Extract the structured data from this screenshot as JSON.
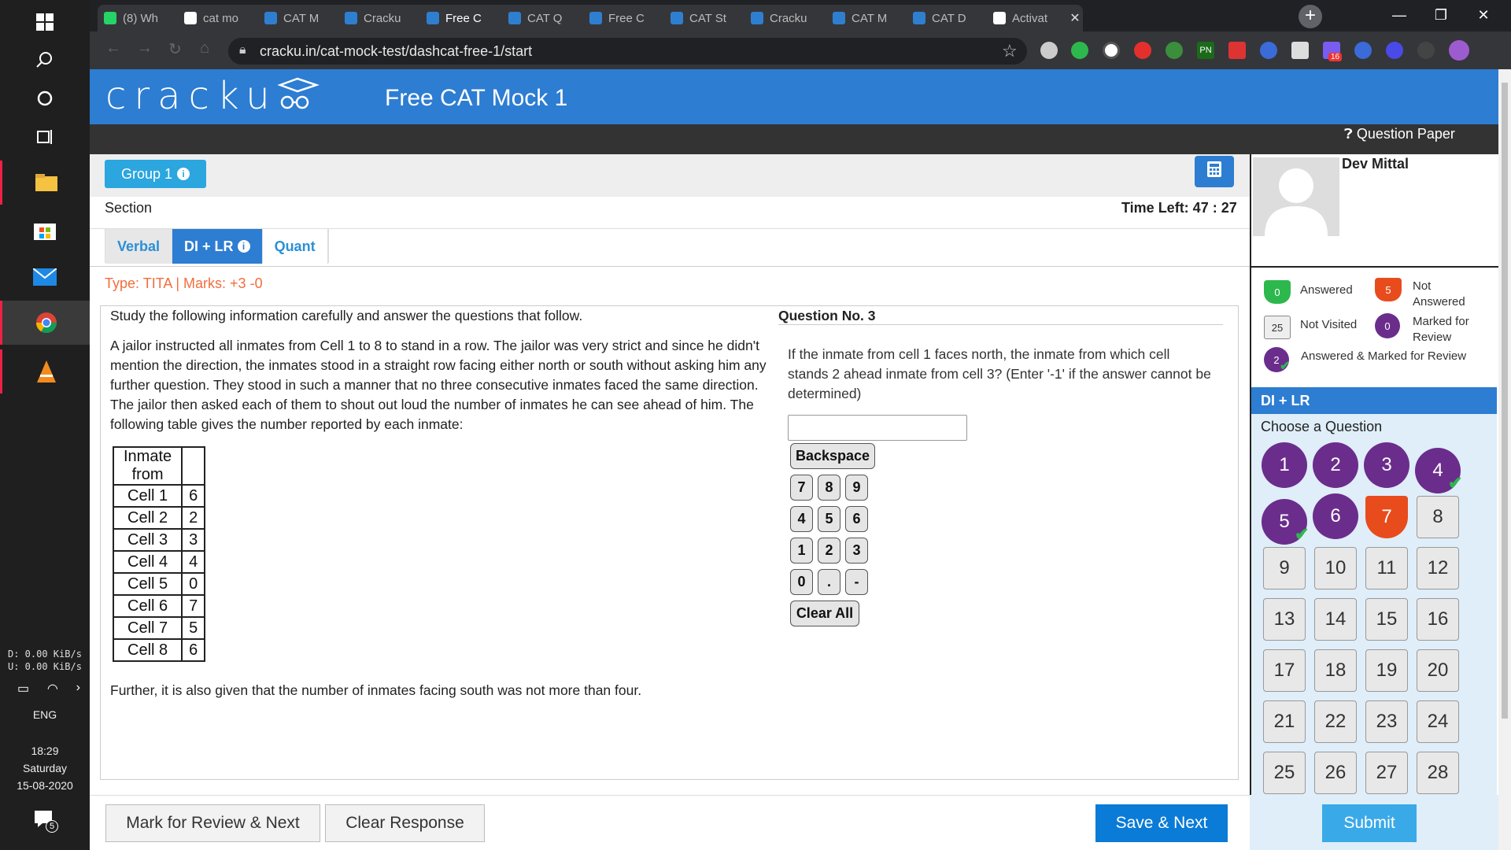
{
  "taskbar": {
    "net_down": "D:    0.00 KiB/s",
    "net_up": "U:    0.00 KiB/s",
    "lang": "ENG",
    "time": "18:29",
    "day": "Saturday",
    "date": "15-08-2020",
    "notif_count": "5"
  },
  "browser": {
    "tabs": [
      {
        "title": "(8) Wh"
      },
      {
        "title": "cat mo"
      },
      {
        "title": "CAT M"
      },
      {
        "title": "Cracku"
      },
      {
        "title": "Free C"
      },
      {
        "title": "CAT Q"
      },
      {
        "title": "Free C"
      },
      {
        "title": "CAT St"
      },
      {
        "title": "Cracku"
      },
      {
        "title": "CAT M"
      },
      {
        "title": "CAT D"
      },
      {
        "title": "Activat"
      }
    ],
    "url": "cracku.in/cat-mock-test/dashcat-free-1/start",
    "ext_badge": "16",
    "ext_pn": "PN"
  },
  "header": {
    "logo": "cracku",
    "title": "Free CAT Mock 1",
    "question_paper": "Question Paper"
  },
  "group": {
    "label": "Group 1"
  },
  "section": {
    "label": "Section",
    "time_left": "Time Left: 47 : 27",
    "tabs": [
      {
        "label": "Verbal"
      },
      {
        "label": "DI + LR"
      },
      {
        "label": "Quant"
      }
    ]
  },
  "question": {
    "type": "Type: TITA | Marks: +3 -0",
    "passage_head": "Study the following information carefully and answer the questions that follow.",
    "passage_lines": [
      "A jailor instructed all inmates from Cell 1 to 8 to stand in a row. The jailor was very strict and since he didn't",
      "mention the direction, the inmates stood in a straight row facing either north or south without asking him any",
      "further question. They stood in such a manner that no three consecutive inmates faced the same direction.",
      "The jailor then asked each of them to shout out loud the number of inmates he can see ahead of him. The",
      "following table gives the number reported by each inmate:"
    ],
    "table_header": [
      "Inmate",
      "from"
    ],
    "table_rows": [
      {
        "cell": "Cell 1",
        "value": "6"
      },
      {
        "cell": "Cell 2",
        "value": "2"
      },
      {
        "cell": "Cell 3",
        "value": "3"
      },
      {
        "cell": "Cell 4",
        "value": "4"
      },
      {
        "cell": "Cell 5",
        "value": "0"
      },
      {
        "cell": "Cell 6",
        "value": "7"
      },
      {
        "cell": "Cell 7",
        "value": "5"
      },
      {
        "cell": "Cell 8",
        "value": "6"
      }
    ],
    "passage_foot": "Further, it is also given that the number of inmates facing south was not more than four.",
    "number": "Question No. 3",
    "text_lines": [
      "If the inmate from cell 1 faces north, the inmate from which cell",
      "stands 2 ahead inmate from cell 3? (Enter '-1' if the answer cannot be",
      "determined)"
    ],
    "answer_value": ""
  },
  "keypad": {
    "backspace": "Backspace",
    "keys": [
      "7",
      "8",
      "9",
      "4",
      "5",
      "6",
      "1",
      "2",
      "3",
      "0",
      ".",
      "-"
    ],
    "clear_all": "Clear All"
  },
  "actions": {
    "mark_review": "Mark for Review & Next",
    "clear_response": "Clear Response",
    "save_next": "Save & Next",
    "submit": "Submit"
  },
  "candidate": {
    "name": "Dev Mittal"
  },
  "legend": {
    "answered_count": "0",
    "answered_label": "Answered",
    "not_answered_count": "5",
    "not_answered_label": [
      "Not",
      "Answered"
    ],
    "not_visited_count": "25",
    "not_visited_label": "Not Visited",
    "marked_count": "0",
    "marked_label": [
      "Marked for",
      "Review"
    ],
    "answered_marked_count": "2",
    "answered_marked_label": "Answered & Marked for Review"
  },
  "palette": {
    "section_title": "DI + LR",
    "choose_label": "Choose a Question",
    "questions": [
      {
        "n": "1",
        "status": "marked"
      },
      {
        "n": "2",
        "status": "marked"
      },
      {
        "n": "3",
        "status": "marked"
      },
      {
        "n": "4",
        "status": "answered-marked"
      },
      {
        "n": "5",
        "status": "answered-marked"
      },
      {
        "n": "6",
        "status": "marked"
      },
      {
        "n": "7",
        "status": "not-answered"
      },
      {
        "n": "8",
        "status": "not-visited"
      },
      {
        "n": "9",
        "status": "not-visited"
      },
      {
        "n": "10",
        "status": "not-visited"
      },
      {
        "n": "11",
        "status": "not-visited"
      },
      {
        "n": "12",
        "status": "not-visited"
      },
      {
        "n": "13",
        "status": "not-visited"
      },
      {
        "n": "14",
        "status": "not-visited"
      },
      {
        "n": "15",
        "status": "not-visited"
      },
      {
        "n": "16",
        "status": "not-visited"
      },
      {
        "n": "17",
        "status": "not-visited"
      },
      {
        "n": "18",
        "status": "not-visited"
      },
      {
        "n": "19",
        "status": "not-visited"
      },
      {
        "n": "20",
        "status": "not-visited"
      },
      {
        "n": "21",
        "status": "not-visited"
      },
      {
        "n": "22",
        "status": "not-visited"
      },
      {
        "n": "23",
        "status": "not-visited"
      },
      {
        "n": "24",
        "status": "not-visited"
      },
      {
        "n": "25",
        "status": "not-visited"
      },
      {
        "n": "26",
        "status": "not-visited"
      },
      {
        "n": "27",
        "status": "not-visited"
      },
      {
        "n": "28",
        "status": "not-visited"
      }
    ]
  },
  "colors": {
    "brand_blue": "#2d7dd2",
    "marked_purple": "#6b2d8c",
    "not_answered_orange": "#e84c1d",
    "answered_green": "#2db84d",
    "type_orange": "#f26d3d"
  }
}
